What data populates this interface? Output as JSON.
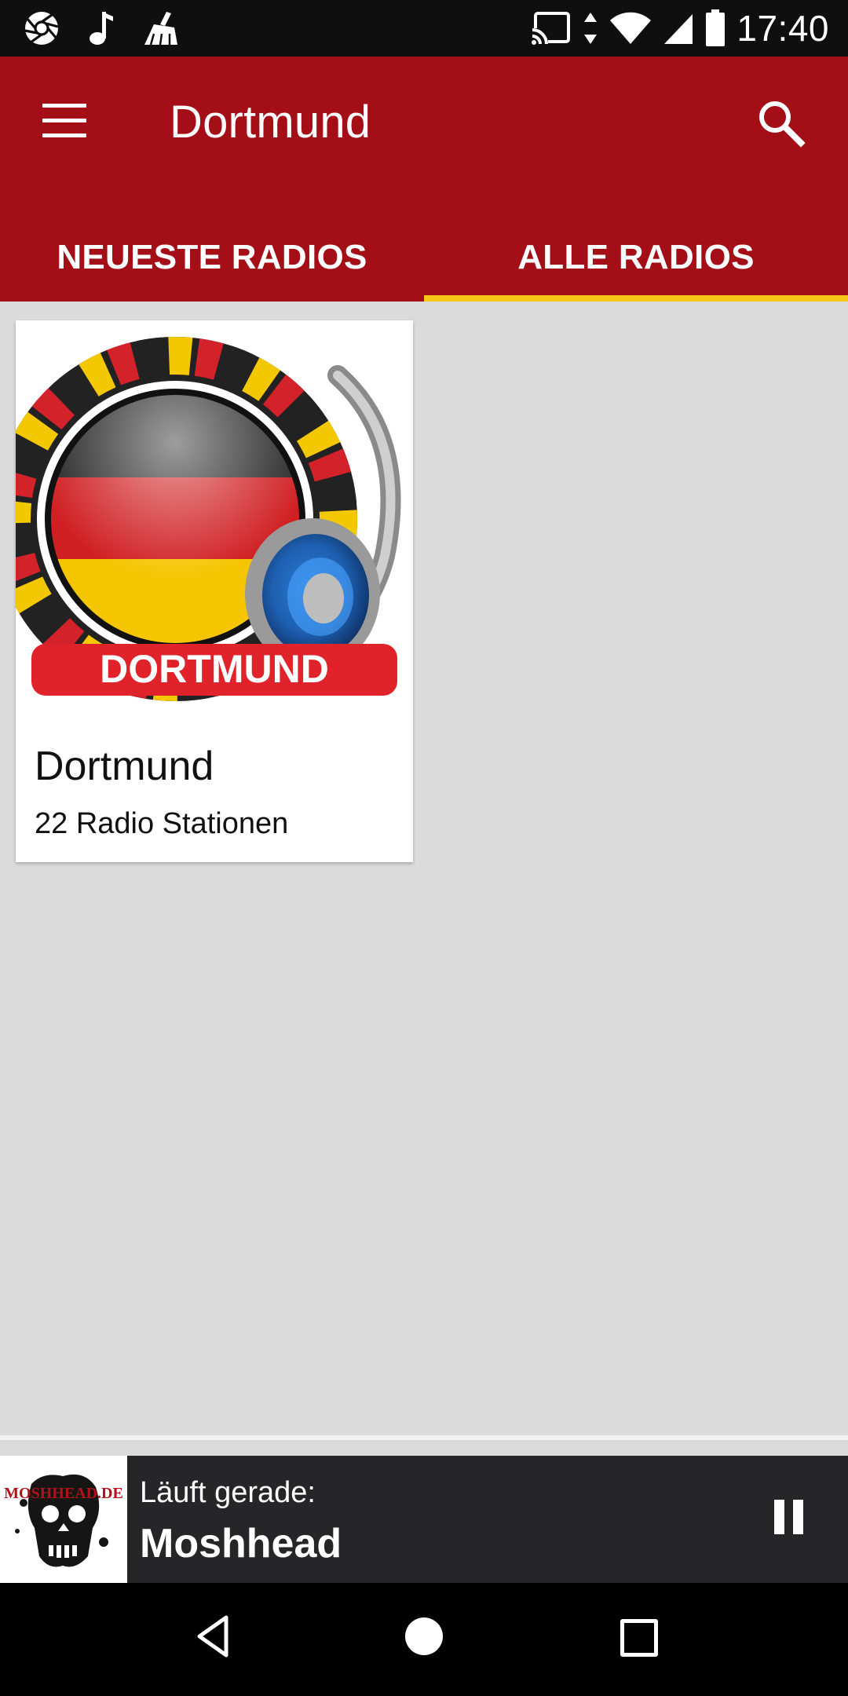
{
  "status_bar": {
    "time": "17:40",
    "left_icons": [
      "aperture-icon",
      "music-note-icon",
      "broom-icon"
    ],
    "right_icons": [
      "cast-icon",
      "data-arrows-icon",
      "wifi-icon",
      "cell-signal-icon",
      "battery-icon"
    ]
  },
  "app_bar": {
    "title": "Dortmund",
    "menu_icon": "hamburger-menu-icon",
    "search_icon": "search-icon",
    "background_color": "#a30e17"
  },
  "tabs": [
    {
      "label": "NEUESTE RADIOS",
      "selected": false
    },
    {
      "label": "ALLE RADIOS",
      "selected": true
    }
  ],
  "tab_indicator_color": "#f6c619",
  "cards": [
    {
      "logo_label": "DORTMUND",
      "title": "Dortmund",
      "subtitle": "22 Radio Stationen"
    }
  ],
  "player": {
    "label": "Läuft gerade:",
    "station": "Moshhead",
    "thumb_text": "MOSHHEAD.DE",
    "control_icon": "pause-icon"
  },
  "nav_bar": {
    "icons": [
      "back-icon",
      "home-icon",
      "recent-apps-icon"
    ]
  }
}
